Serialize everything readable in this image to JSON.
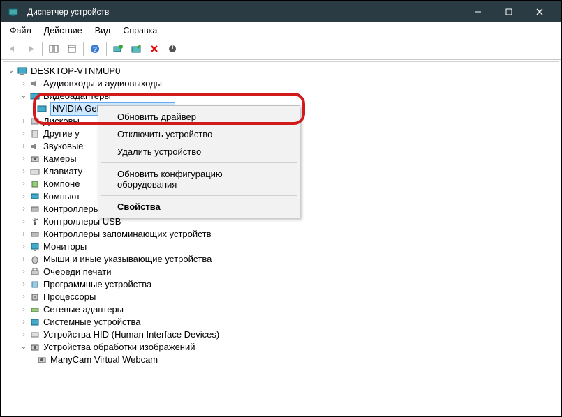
{
  "titlebar": {
    "title": "Диспетчер устройств"
  },
  "menu": {
    "file": "Файл",
    "action": "Действие",
    "view": "Вид",
    "help": "Справка"
  },
  "tree": {
    "root": "DESKTOP-VTNMUP0",
    "audio": "Аудиовходы и аудиовыходы",
    "video": "Видеоадаптеры",
    "gpu": "NVIDIA GeForce GTX 1050 Ti",
    "disk": "Дисковы",
    "other": "Другие у",
    "sound": "Звуковые",
    "cameras": "Камеры",
    "keyboards": "Клавиату",
    "components": "Компоне",
    "computer": "Компьют",
    "ide": "Контроллеры IDE ATA/ATAPI",
    "usb": "Контроллеры USB",
    "storage": "Контроллеры запоминающих устройств",
    "monitors": "Мониторы",
    "mice": "Мыши и иные указывающие устройства",
    "print": "Очереди печати",
    "software": "Программные устройства",
    "cpu": "Процессоры",
    "net": "Сетевые адаптеры",
    "system": "Системные устройства",
    "hid": "Устройства HID (Human Interface Devices)",
    "imaging": "Устройства обработки изображений",
    "webcam": "ManyCam Virtual Webcam"
  },
  "ctx": {
    "update": "Обновить драйвер",
    "disable": "Отключить устройство",
    "uninstall": "Удалить устройство",
    "scan": "Обновить конфигурацию оборудования",
    "properties": "Свойства"
  }
}
